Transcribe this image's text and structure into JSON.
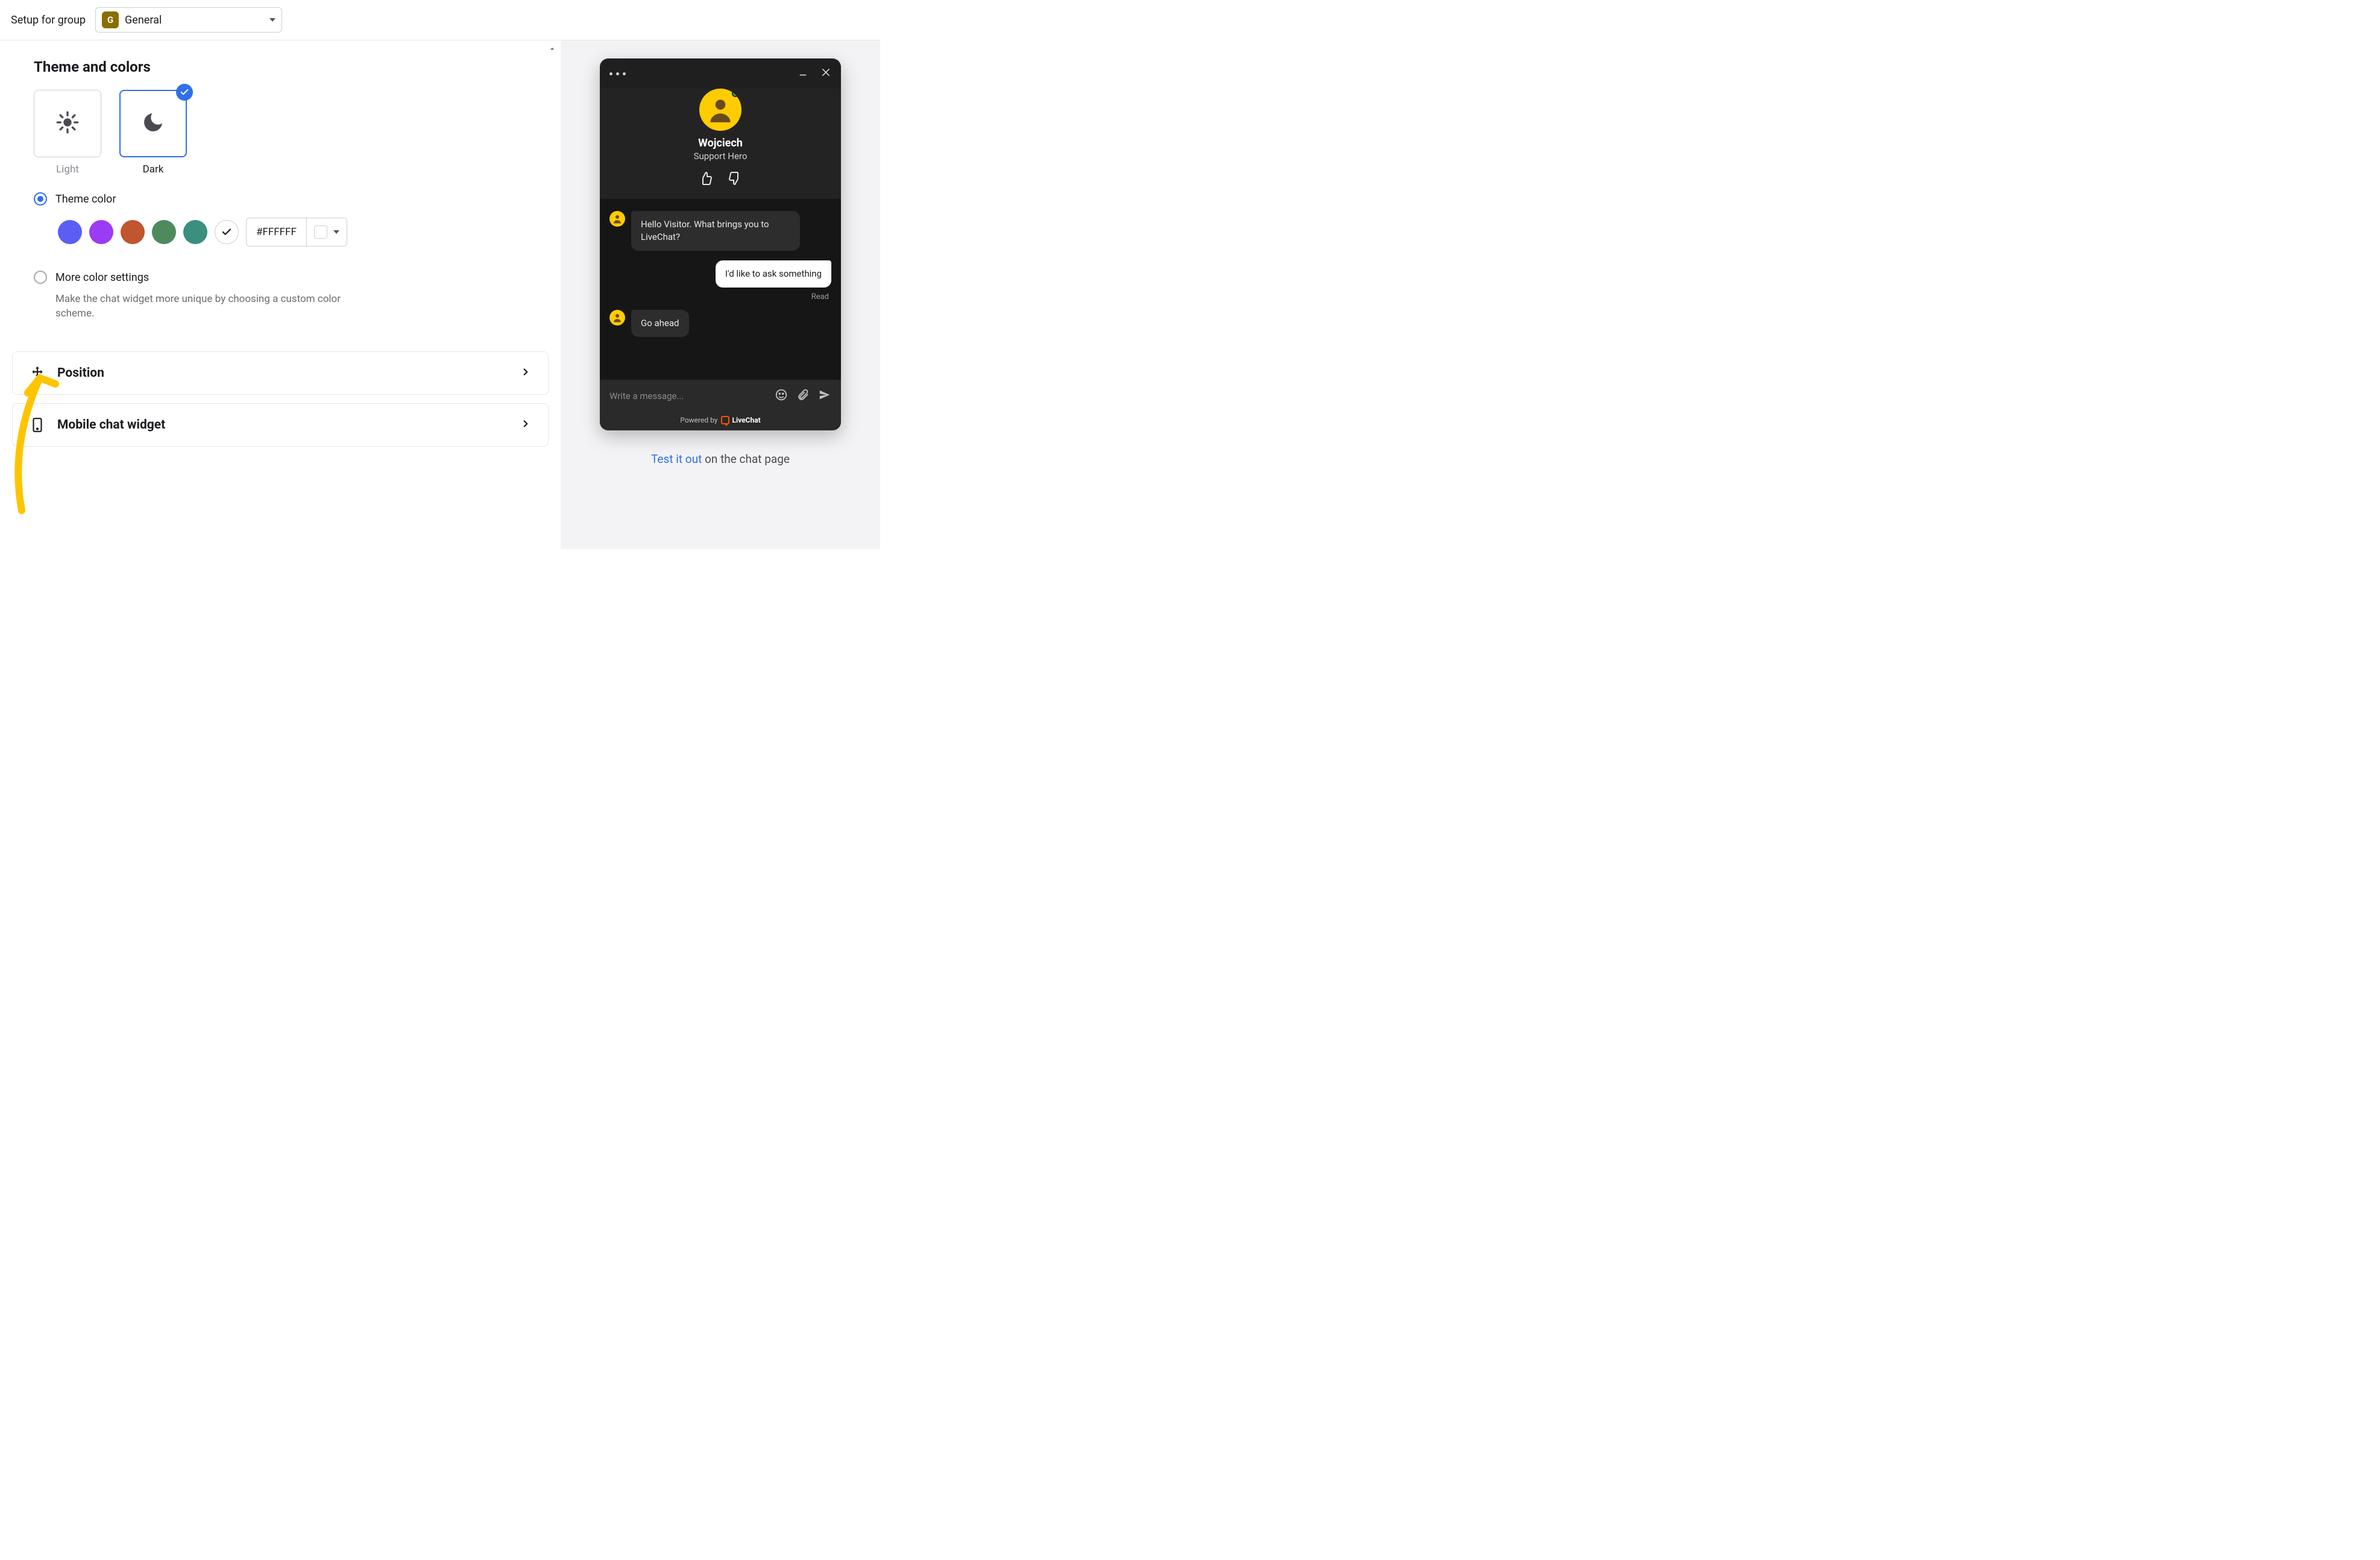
{
  "topbar": {
    "label": "Setup for group",
    "group_badge": "G",
    "group_name": "General"
  },
  "theme": {
    "section_title": "Theme and colors",
    "options": [
      {
        "label": "Light",
        "selected": false
      },
      {
        "label": "Dark",
        "selected": true
      }
    ],
    "theme_color": {
      "radio_label": "Theme color",
      "checked": true,
      "swatches": [
        "#5b5ef4",
        "#9b3bf4",
        "#c0552f",
        "#4e8a5b",
        "#3a8f7f"
      ],
      "hex_value": "#FFFFFF"
    },
    "more_colors": {
      "radio_label": "More color settings",
      "checked": false,
      "description": "Make the chat widget more unique by choosing a custom color scheme."
    }
  },
  "rows": {
    "position": "Position",
    "mobile": "Mobile chat widget"
  },
  "widget": {
    "agent_name": "Wojciech",
    "agent_role": "Support Hero",
    "messages": [
      {
        "from": "agent",
        "text": "Hello Visitor. What brings you to LiveChat?"
      },
      {
        "from": "visitor",
        "text": "I'd like to ask something"
      },
      {
        "from": "agent",
        "text": "Go ahead"
      }
    ],
    "read_receipt": "Read",
    "input_placeholder": "Write a message...",
    "powered_by": "Powered by",
    "brand": "LiveChat"
  },
  "cta": {
    "link": "Test it out",
    "rest": " on the chat page"
  }
}
